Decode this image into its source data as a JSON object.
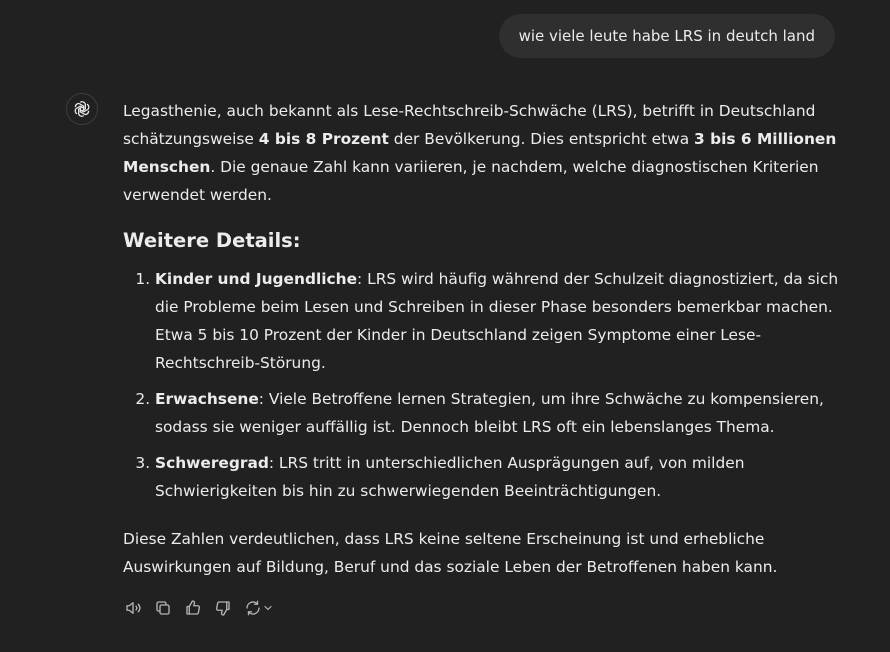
{
  "user_message": {
    "text": "wie viele leute habe LRS in deutch land"
  },
  "assistant": {
    "avatar_icon": "openai-logo-icon",
    "intro": {
      "t1": "Legasthenie, auch bekannt als Lese-Rechtschreib-Schwäche (LRS), betrifft in Deutschland schätzungsweise ",
      "b1": "4 bis 8 Prozent",
      "t2": " der Bevölkerung. Dies entspricht etwa ",
      "b2": "3 bis 6 Millionen Menschen",
      "t3": ". Die genaue Zahl kann variieren, je nachdem, welche diagnostischen Kriterien verwendet werden."
    },
    "heading": "Weitere Details:",
    "list": [
      {
        "term": "Kinder und Jugendliche",
        "text": ": LRS wird häufig während der Schulzeit diagnostiziert, da sich die Probleme beim Lesen und Schreiben in dieser Phase besonders bemerkbar machen. Etwa 5 bis 10 Prozent der Kinder in Deutschland zeigen Symptome einer Lese-Rechtschreib-Störung."
      },
      {
        "term": "Erwachsene",
        "text": ": Viele Betroffene lernen Strategien, um ihre Schwäche zu kompensieren, sodass sie weniger auffällig ist. Dennoch bleibt LRS oft ein lebenslanges Thema."
      },
      {
        "term": "Schweregrad",
        "text": ": LRS tritt in unterschiedlichen Ausprägungen auf, von milden Schwierigkeiten bis hin zu schwerwiegenden Beeinträchtigungen."
      }
    ],
    "closing": "Diese Zahlen verdeutlichen, dass LRS keine seltene Erscheinung ist und erhebliche Auswirkungen auf Bildung, Beruf und das soziale Leben der Betroffenen haben kann."
  },
  "actions": [
    {
      "icon": "speaker-icon"
    },
    {
      "icon": "copy-icon"
    },
    {
      "icon": "thumbs-up-icon"
    },
    {
      "icon": "thumbs-down-icon"
    },
    {
      "icon": "regenerate-icon"
    }
  ],
  "colors": {
    "background": "#212121",
    "user_bubble": "#2f2f2f",
    "text": "#ececec",
    "icon": "#b4b4b4"
  }
}
